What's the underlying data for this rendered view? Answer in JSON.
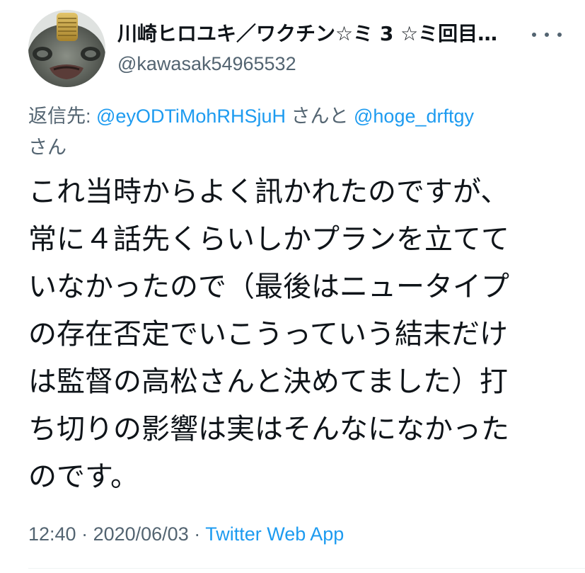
{
  "user": {
    "display_name": "川崎ヒロユキ／ワクチン☆ミ 3 ☆ミ回目…",
    "handle": "@kawasak54965532",
    "avatar": "avatar-image"
  },
  "reply": {
    "prefix": "返信先: ",
    "mention1": "@eyODTiMohRHSjuH",
    "and": " さんと ",
    "mention2": "@hoge_drftgy",
    "suffix": "さん"
  },
  "tweet": {
    "lines": [
      "これ当時からよく訊かれたのですが、",
      "常に４話先くらいしかプランを立てて",
      "いなかったので（最後はニュータイプ",
      "の存在否定でいこうっていう結末だけ",
      "は監督の高松さんと決めてました）打",
      "ち切りの影響は実はそんなになかった",
      "のです。"
    ]
  },
  "meta": {
    "time": "12:40",
    "sep1": " · ",
    "date": "2020/06/03",
    "sep2": " · ",
    "source": "Twitter Web App"
  },
  "icons": {
    "more": "more-options-icon"
  },
  "colors": {
    "text": "#0f1419",
    "secondary": "#536471",
    "link": "#1d9bf0"
  }
}
